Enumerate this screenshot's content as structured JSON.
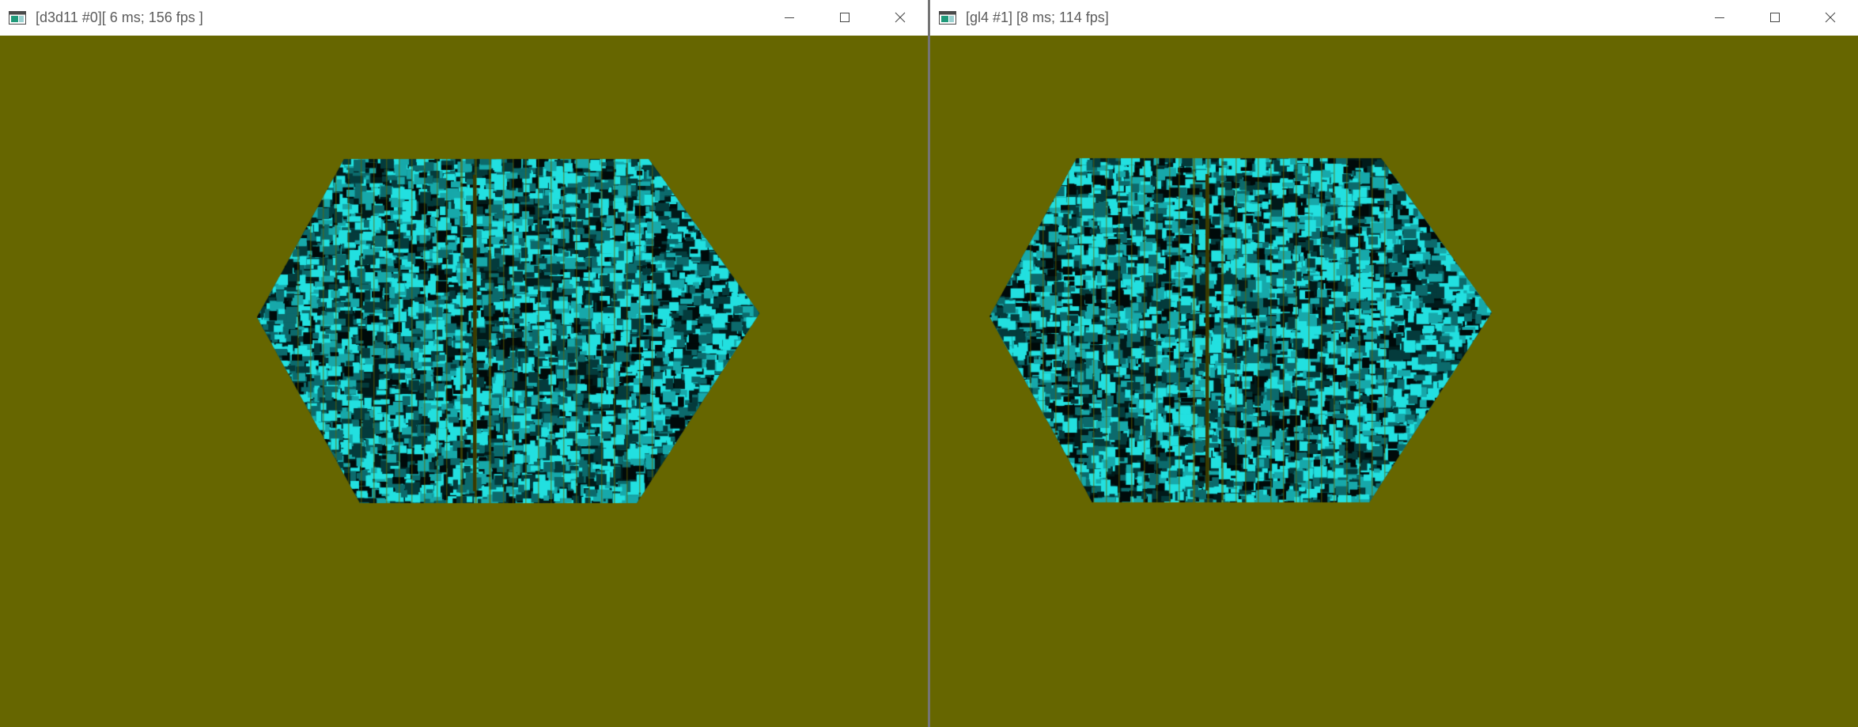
{
  "windows": [
    {
      "title": "[d3d11 #0][ 6 ms; 156 fps ]",
      "icon": "app-window-icon",
      "controls": {
        "minimize": "minimize-icon",
        "maximize": "maximize-icon",
        "close": "close-icon"
      }
    },
    {
      "title": "[gl4 #1] [8 ms; 114 fps]",
      "icon": "app-window-icon",
      "controls": {
        "minimize": "minimize-icon",
        "maximize": "maximize-icon",
        "close": "close-icon"
      }
    }
  ],
  "colors": {
    "viewport_background": "#666600",
    "title_text": "#5c5c5c",
    "cube_cyan": "#1fd6d6",
    "cube_dark": "#022626"
  }
}
